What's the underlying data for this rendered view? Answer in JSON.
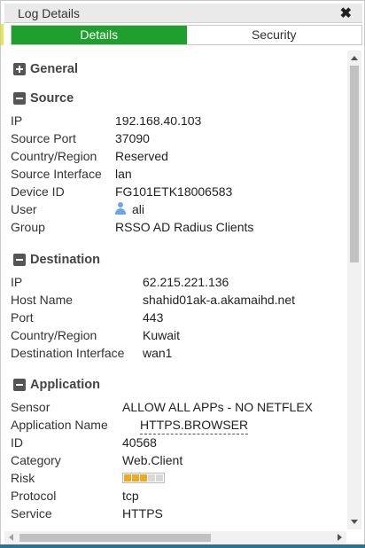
{
  "window": {
    "title": "Log Details",
    "close_glyph": "✖"
  },
  "tabs": [
    {
      "label": "Details",
      "active": true
    },
    {
      "label": "Security",
      "active": false
    }
  ],
  "sections": {
    "general": {
      "title": "General",
      "expanded": false
    },
    "source": {
      "title": "Source",
      "expanded": true,
      "rows": [
        {
          "label": "IP",
          "value": "192.168.40.103"
        },
        {
          "label": "Source Port",
          "value": "37090"
        },
        {
          "label": "Country/Region",
          "value": "Reserved"
        },
        {
          "label": "Source Interface",
          "value": "lan"
        },
        {
          "label": "Device ID",
          "value": "FG101ETK18006583"
        },
        {
          "label": "User",
          "value": "ali",
          "icon": "user-icon"
        },
        {
          "label": "Group",
          "value": "RSSO AD Radius Clients"
        }
      ]
    },
    "destination": {
      "title": "Destination",
      "expanded": true,
      "rows": [
        {
          "label": "IP",
          "value": "62.215.221.136"
        },
        {
          "label": "Host Name",
          "value": "shahid01ak-a.akamaihd.net"
        },
        {
          "label": "Port",
          "value": "443"
        },
        {
          "label": "Country/Region",
          "value": "Kuwait"
        },
        {
          "label": "Destination Interface",
          "value": "wan1"
        }
      ]
    },
    "application": {
      "title": "Application",
      "expanded": true,
      "rows": [
        {
          "label": "Sensor",
          "value": "ALLOW ALL APPs - NO NETFLEX"
        },
        {
          "label": "Application Name",
          "value": "HTTPS.BROWSER"
        },
        {
          "label": "ID",
          "value": "40568"
        },
        {
          "label": "Category",
          "value": "Web.Client"
        },
        {
          "label": "Risk",
          "risk_level": 3,
          "risk_max": 5
        },
        {
          "label": "Protocol",
          "value": "tcp"
        },
        {
          "label": "Service",
          "value": "HTTPS"
        }
      ]
    }
  },
  "colors": {
    "active_tab": "#1e9f2e",
    "risk_on": "#efaa22",
    "risk_off": "#d8d8d8",
    "user_icon": "#6aa6e8"
  }
}
